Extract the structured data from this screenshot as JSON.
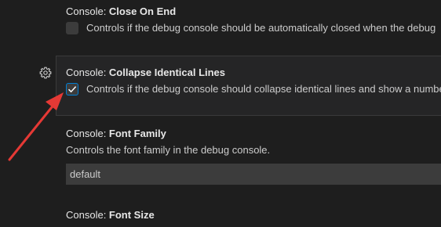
{
  "settings": [
    {
      "category": "Console: ",
      "label": "Close On End",
      "description": "Controls if the debug console should be automatically closed when the debug",
      "checked": false
    },
    {
      "category": "Console: ",
      "label": "Collapse Identical Lines",
      "description": "Controls if the debug console should collapse identical lines and show a numbe",
      "checked": true
    },
    {
      "category": "Console: ",
      "label": "Font Family",
      "description": "Controls the font family in the debug console.",
      "value": "default"
    },
    {
      "category": "Console: ",
      "label": "Font Size"
    }
  ],
  "icons": {
    "gear": "gear-icon",
    "check": "checkmark-icon",
    "annotation": "red-arrow-annotation"
  },
  "colors": {
    "background": "#1e1e1e",
    "focused_row": "#252526",
    "checkbox_focus": "#007fd4",
    "annotation_arrow": "#e53935"
  }
}
